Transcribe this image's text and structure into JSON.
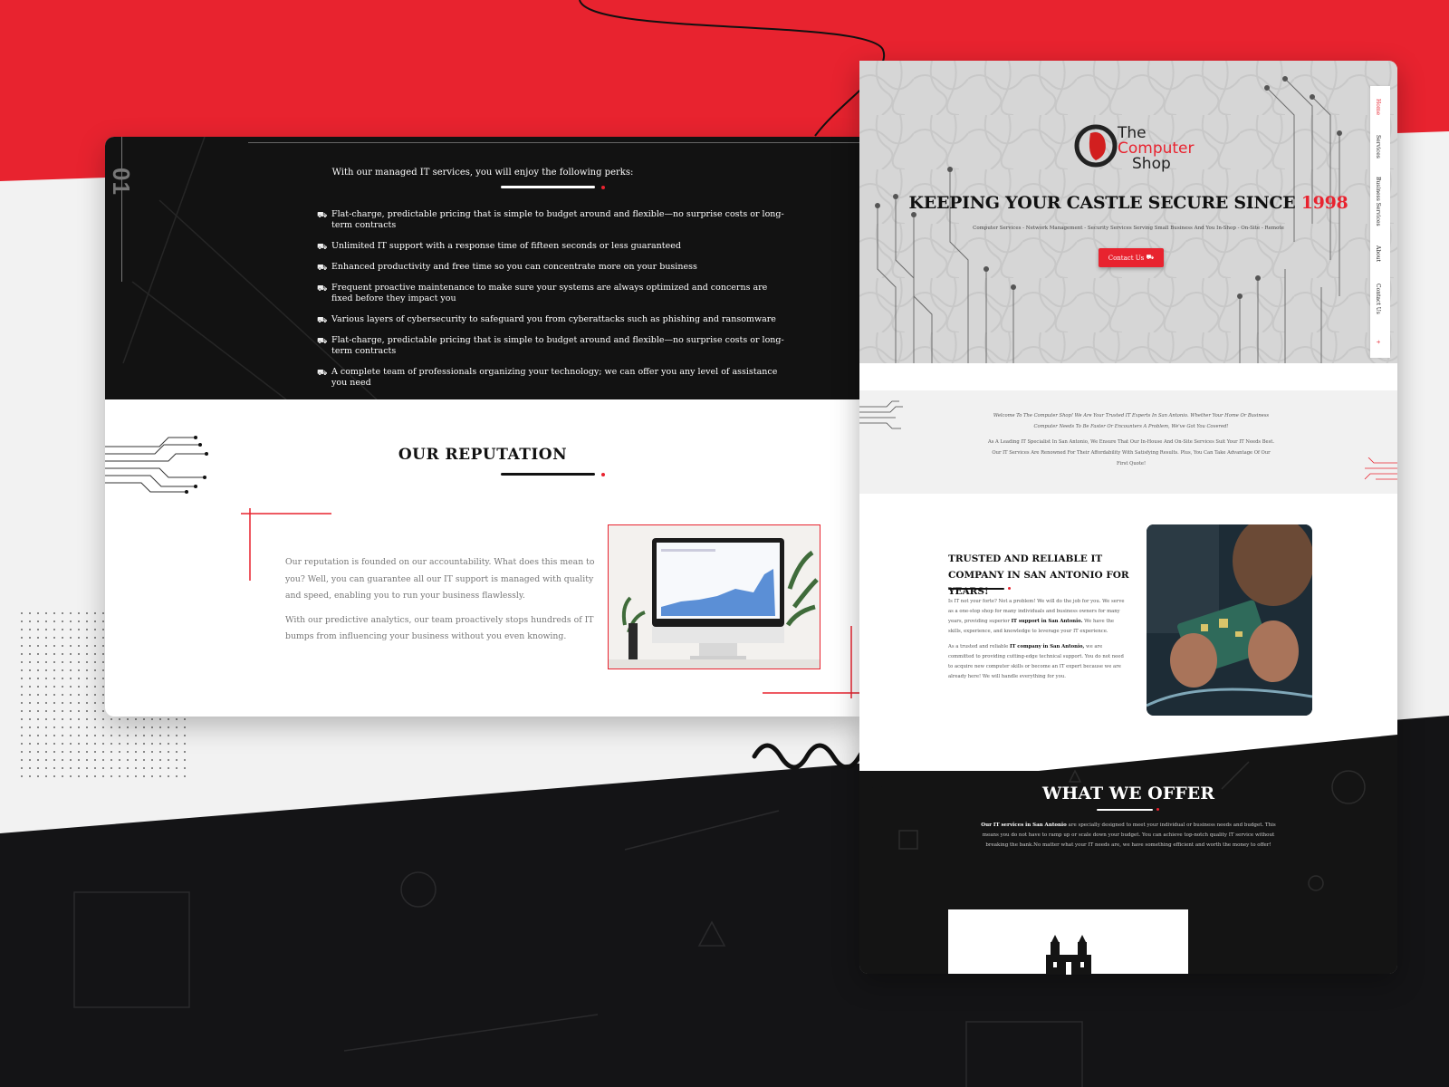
{
  "section_number": "01",
  "perks": {
    "title": "With our managed IT services, you will enjoy the following perks:",
    "items": [
      "Flat-charge, predictable pricing that is simple to budget around and flexible—no surprise costs or long-term contracts",
      "Unlimited IT support with a response time of fifteen seconds or less guaranteed",
      "Enhanced productivity and free time so you can concentrate more on your business",
      "Frequent proactive maintenance to make sure your systems are always optimized and concerns are fixed before they impact you",
      "Various layers of cybersecurity to safeguard you from cyberattacks such as phishing and ransomware",
      "Flat-charge, predictable pricing that is simple to budget around and flexible—no surprise costs or long-term contracts",
      "A complete team of professionals organizing your technology; we can offer you any level of assistance you need"
    ]
  },
  "reputation": {
    "title": "OUR REPUTATION",
    "paragraph1": "Our reputation is founded on our accountability. What does this mean to you? Well, you can guarantee all our IT support is managed with quality and speed, enabling you to run your business flawlessly.",
    "paragraph2": "With our predictive analytics, our team proactively stops hundreds of IT bumps from influencing your business without you even knowing."
  },
  "hero": {
    "logo_line1": "The",
    "logo_line2": "Computer",
    "logo_line3": "Shop",
    "title": "KEEPING YOUR CASTLE SECURE SINCE",
    "title_year": "1998",
    "subtitle": "Computer Services - Network Management - Security Services Serving Small Business And You In-Shop - On-Site - Remote",
    "cta_label": "Contact Us"
  },
  "nav": {
    "items": [
      "Home",
      "Services",
      "Business Services",
      "About",
      "Contact Us"
    ]
  },
  "welcome": {
    "line1": "Welcome To The Computer Shop! We Are Your Trusted IT Experts In San Antonio. Whether Your Home Or Business Computer Needs To Be Faster Or Encounters A Problem, We've Got You Covered!",
    "line2": "As A Leading IT Specialist In San Antonio, We Ensure That Our In-House And On-Site Services Suit Your IT Needs Best. Our IT Services Are Renowned For Their Affordability With Satisfying Results. Plus, You Can Take Advantage Of Our First Quote!"
  },
  "trusted": {
    "title": "TRUSTED AND RELIABLE IT COMPANY IN SAN ANTONIO FOR YEARS!",
    "p1_a": "Is IT not your forte? Not a problem! We will do the job for you. We serve as a one-stop shop for many individuals and business owners for many years, providing superior ",
    "p1_bold": "IT support in San Antonio.",
    "p1_b": " We have the skills, experience, and knowledge to leverage your IT experience.",
    "p2_a": "As a trusted and reliable ",
    "p2_bold": "IT company in San Antonio,",
    "p2_b": " we are committed to providing cutting-edge technical support. You do not need to acquire new computer skills or become an IT expert because we are already here! We will handle everything for you."
  },
  "offer": {
    "title": "WHAT WE OFFER",
    "text_bold": "Our IT services in San Antonio",
    "text": " are specially designed to meet your individual or business needs and budget. This means you do not have to ramp up or scale down your budget. You can achieve top-notch quality IT service without breaking the bank.No matter what your IT needs are, we have something efficient and worth the money to offer!"
  },
  "colors": {
    "accent": "#e8232f",
    "dark": "#141416",
    "light": "#f2f2f2"
  }
}
